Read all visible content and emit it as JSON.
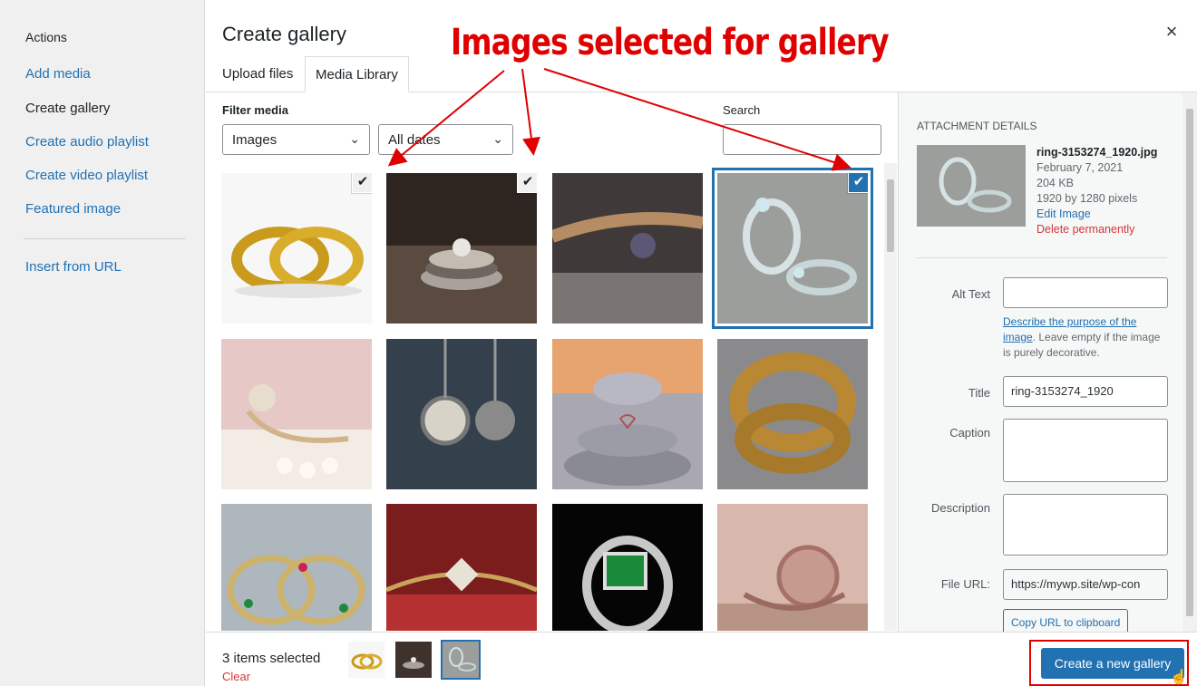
{
  "sidebar": {
    "heading": "Actions",
    "items": [
      {
        "label": "Add media"
      },
      {
        "label": "Create gallery"
      },
      {
        "label": "Create audio playlist"
      },
      {
        "label": "Create video playlist"
      },
      {
        "label": "Featured image"
      },
      {
        "label": "Insert from URL"
      }
    ]
  },
  "header": {
    "title": "Create gallery",
    "close": "×",
    "annotation": "Images selected for gallery"
  },
  "tabs": [
    {
      "label": "Upload files"
    },
    {
      "label": "Media Library"
    }
  ],
  "toolbar": {
    "filter_label": "Filter media",
    "type_value": "Images",
    "date_value": "All dates",
    "search_label": "Search",
    "search_value": ""
  },
  "grid": {
    "items": [
      {
        "name": "gold-wedding-rings",
        "selected": true,
        "current": false
      },
      {
        "name": "diamond-ring-stack",
        "selected": true,
        "current": false
      },
      {
        "name": "purple-flower-ring",
        "selected": false,
        "current": false
      },
      {
        "name": "ring-3153274_1920",
        "selected": true,
        "current": true
      },
      {
        "name": "pink-pearl-ring",
        "selected": false,
        "current": false
      },
      {
        "name": "pocket-watch-pendant",
        "selected": false,
        "current": false
      },
      {
        "name": "heart-pendant-stones",
        "selected": false,
        "current": false
      },
      {
        "name": "turquoise-bangle",
        "selected": false,
        "current": false
      },
      {
        "name": "gemstone-bangles",
        "selected": false,
        "current": false
      },
      {
        "name": "diamond-bracelet-red",
        "selected": false,
        "current": false
      },
      {
        "name": "emerald-ring-black",
        "selected": false,
        "current": false
      },
      {
        "name": "rose-quartz-ring",
        "selected": false,
        "current": false
      }
    ],
    "check": "✔"
  },
  "details": {
    "title": "ATTACHMENT DETAILS",
    "filename": "ring-3153274_1920.jpg",
    "date": "February 7, 2021",
    "size": "204 KB",
    "dimensions": "1920 by 1280 pixels",
    "edit_label": "Edit Image",
    "delete_label": "Delete permanently",
    "alt_label": "Alt Text",
    "alt_value": "",
    "alt_help_link": "Describe the purpose of the image",
    "alt_help_text": ". Leave empty if the image is purely decorative.",
    "title_label": "Title",
    "title_value": "ring-3153274_1920",
    "caption_label": "Caption",
    "caption_value": "",
    "description_label": "Description",
    "description_value": "",
    "url_label": "File URL:",
    "url_value": "https://mywp.site/wp-con",
    "copy_label": "Copy URL to clipboard"
  },
  "footer": {
    "selected_count": "3 items selected",
    "clear_label": "Clear",
    "create_label": "Create a new gallery"
  },
  "colors": {
    "accent": "#2271b1",
    "danger": "#d63638",
    "annotation": "#e00000"
  }
}
